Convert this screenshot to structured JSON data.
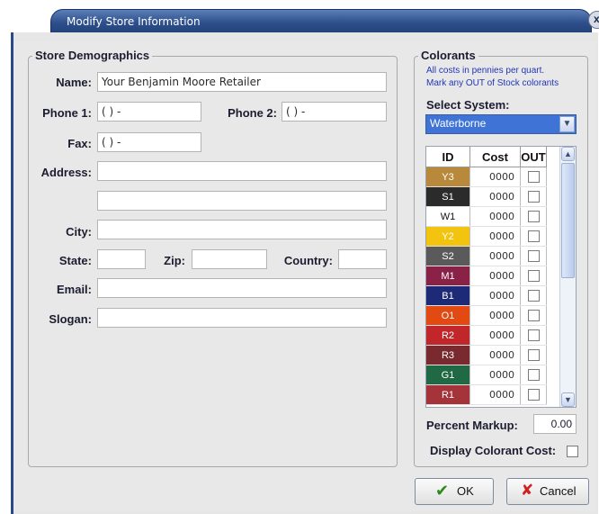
{
  "window": {
    "title": "Modify Store Information",
    "close_label": "x"
  },
  "demographics": {
    "group_label": "Store Demographics",
    "name_label": "Name:",
    "name_value": "Your Benjamin Moore Retailer",
    "phone1_label": "Phone 1:",
    "phone1_value": "(  )  -",
    "phone2_label": "Phone 2:",
    "phone2_value": "(  )  -",
    "fax_label": "Fax:",
    "fax_value": "(  )  -",
    "address_label": "Address:",
    "address_value": "",
    "address2_value": "",
    "city_label": "City:",
    "city_value": "",
    "state_label": "State:",
    "state_value": "",
    "zip_label": "Zip:",
    "zip_value": "",
    "country_label": "Country:",
    "country_value": "",
    "email_label": "Email:",
    "email_value": "",
    "slogan_label": "Slogan:",
    "slogan_value": ""
  },
  "colorants": {
    "group_label": "Colorants",
    "note1": "All costs in pennies per quart.",
    "note2": "Mark any OUT of Stock colorants",
    "select_label": "Select System:",
    "select_value": "Waterborne",
    "columns": [
      "ID",
      "Cost",
      "OUT"
    ],
    "rows": [
      {
        "id": "Y3",
        "cost": "0000",
        "color": "#b8893a",
        "text": "#ffffff"
      },
      {
        "id": "S1",
        "cost": "0000",
        "color": "#2b2b2b",
        "text": "#ffffff"
      },
      {
        "id": "W1",
        "cost": "0000",
        "color": "#ffffff",
        "text": "#111111"
      },
      {
        "id": "Y2",
        "cost": "0000",
        "color": "#f2c40f",
        "text": "#ffffff"
      },
      {
        "id": "S2",
        "cost": "0000",
        "color": "#5a5a5a",
        "text": "#ffffff"
      },
      {
        "id": "M1",
        "cost": "0000",
        "color": "#8a2147",
        "text": "#ffffff"
      },
      {
        "id": "B1",
        "cost": "0000",
        "color": "#1d2a78",
        "text": "#ffffff"
      },
      {
        "id": "O1",
        "cost": "0000",
        "color": "#e24a12",
        "text": "#ffffff"
      },
      {
        "id": "R2",
        "cost": "0000",
        "color": "#c1262b",
        "text": "#ffffff"
      },
      {
        "id": "R3",
        "cost": "0000",
        "color": "#7a2a2f",
        "text": "#ffffff"
      },
      {
        "id": "G1",
        "cost": "0000",
        "color": "#1f6a44",
        "text": "#ffffff"
      },
      {
        "id": "R1",
        "cost": "0000",
        "color": "#a5333a",
        "text": "#ffffff"
      }
    ],
    "percent_markup_label": "Percent Markup:",
    "percent_markup_value": "0.00",
    "display_cost_label": "Display Colorant Cost:"
  },
  "buttons": {
    "ok_label": "OK",
    "cancel_label": "Cancel"
  }
}
